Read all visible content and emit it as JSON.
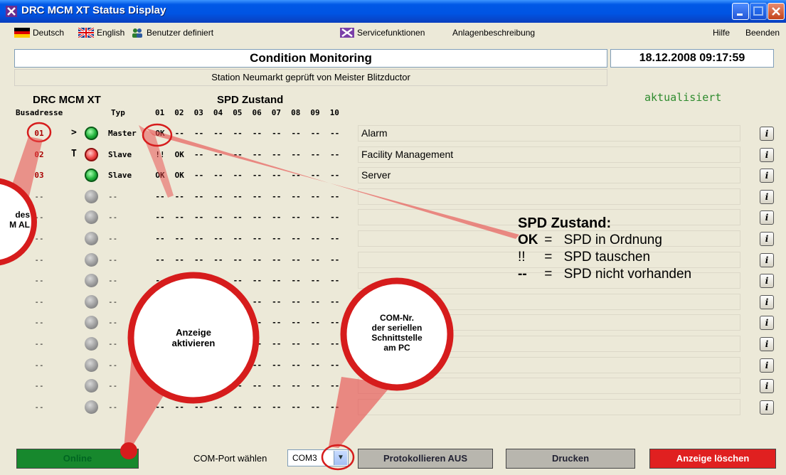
{
  "window": {
    "title": "DRC MCM XT Status Display"
  },
  "menu": {
    "deutsch": "Deutsch",
    "english": "English",
    "custom": "Benutzer definiert",
    "service": "Servicefunktionen",
    "description": "Anlagenbeschreibung",
    "help": "Hilfe",
    "exit": "Beenden"
  },
  "header": {
    "title": "Condition Monitoring",
    "datetime": "18.12.2008  09:17:59",
    "station": "Station Neumarkt geprüft von Meister Blitzductor",
    "col_device": "DRC MCM XT",
    "col_spd": "SPD Zustand",
    "sub_bus": "Busadresse",
    "sub_type": "Typ",
    "slots": [
      "01",
      "02",
      "03",
      "04",
      "05",
      "06",
      "07",
      "08",
      "09",
      "10"
    ],
    "updated": "aktualisiert"
  },
  "rows": [
    {
      "addr": "01",
      "mark": ">",
      "led": "green",
      "type": "Master",
      "spd": [
        "OK",
        "--",
        "--",
        "--",
        "--",
        "--",
        "--",
        "--",
        "--",
        "--"
      ],
      "desc": "Alarm"
    },
    {
      "addr": "02",
      "mark": "T",
      "led": "red",
      "type": "Slave",
      "spd": [
        "!!",
        "OK",
        "--",
        "--",
        "--",
        "--",
        "--",
        "--",
        "--",
        "--"
      ],
      "desc": "Facility Management"
    },
    {
      "addr": "03",
      "mark": "",
      "led": "green",
      "type": "Slave",
      "spd": [
        "OK",
        "OK",
        "--",
        "--",
        "--",
        "--",
        "--",
        "--",
        "--",
        "--"
      ],
      "desc": "Server"
    },
    {
      "addr": "--",
      "mark": "",
      "led": "gray",
      "type": "--",
      "spd": [
        "--",
        "--",
        "--",
        "--",
        "--",
        "--",
        "--",
        "--",
        "--",
        "--"
      ],
      "desc": ""
    },
    {
      "addr": "--",
      "mark": "",
      "led": "gray",
      "type": "--",
      "spd": [
        "--",
        "--",
        "--",
        "--",
        "--",
        "--",
        "--",
        "--",
        "--",
        "--"
      ],
      "desc": ""
    },
    {
      "addr": "--",
      "mark": "",
      "led": "gray",
      "type": "--",
      "spd": [
        "--",
        "--",
        "--",
        "--",
        "--",
        "--",
        "--",
        "--",
        "--",
        "--"
      ],
      "desc": ""
    },
    {
      "addr": "--",
      "mark": "",
      "led": "gray",
      "type": "--",
      "spd": [
        "--",
        "--",
        "--",
        "--",
        "--",
        "--",
        "--",
        "--",
        "--",
        "--"
      ],
      "desc": ""
    },
    {
      "addr": "--",
      "mark": "",
      "led": "gray",
      "type": "--",
      "spd": [
        "--",
        "--",
        "--",
        "--",
        "--",
        "--",
        "--",
        "--",
        "--",
        "--"
      ],
      "desc": ""
    },
    {
      "addr": "--",
      "mark": "",
      "led": "gray",
      "type": "--",
      "spd": [
        "--",
        "--",
        "--",
        "--",
        "--",
        "--",
        "--",
        "--",
        "--",
        "--"
      ],
      "desc": ""
    },
    {
      "addr": "--",
      "mark": "",
      "led": "gray",
      "type": "--",
      "spd": [
        "--",
        "--",
        "--",
        "--",
        "--",
        "--",
        "--",
        "--",
        "--",
        "--"
      ],
      "desc": ""
    },
    {
      "addr": "--",
      "mark": "",
      "led": "gray",
      "type": "--",
      "spd": [
        "--",
        "--",
        "--",
        "--",
        "--",
        "--",
        "--",
        "--",
        "--",
        "--"
      ],
      "desc": ""
    },
    {
      "addr": "--",
      "mark": "",
      "led": "gray",
      "type": "--",
      "spd": [
        "--",
        "--",
        "--",
        "--",
        "--",
        "--",
        "--",
        "--",
        "--",
        "--"
      ],
      "desc": ""
    },
    {
      "addr": "--",
      "mark": "",
      "led": "gray",
      "type": "--",
      "spd": [
        "--",
        "--",
        "--",
        "--",
        "--",
        "--",
        "--",
        "--",
        "--",
        "--"
      ],
      "desc": ""
    },
    {
      "addr": "--",
      "mark": "",
      "led": "gray",
      "type": "--",
      "spd": [
        "--",
        "--",
        "--",
        "--",
        "--",
        "--",
        "--",
        "--",
        "--",
        "--"
      ],
      "desc": ""
    }
  ],
  "info_label": "i",
  "bottom": {
    "online": "Online",
    "com_label": "COM-Port wählen",
    "com_value": "COM3",
    "log": "Protokollieren AUS",
    "print": "Drucken",
    "clear": "Anzeige löschen"
  },
  "legend": {
    "title": "SPD Zustand:",
    "items": [
      {
        "key": "OK",
        "text": "SPD in Ordnung"
      },
      {
        "key": "!!",
        "text": "SPD tauschen"
      },
      {
        "key": "--",
        "text": "SPD nicht vorhanden"
      }
    ],
    "eq": "="
  },
  "callouts": {
    "left": "des\nM AL",
    "activate": "Anzeige\naktivieren",
    "com": "COM-Nr.\nder seriellen\nSchnittstelle\nam PC"
  },
  "colors": {
    "online": "#17882d",
    "log": "#b8b6ae",
    "print": "#b8b6ae",
    "clear": "#e02020",
    "callout_fill": "#e84848",
    "callout_ring": "#d61c1c"
  }
}
